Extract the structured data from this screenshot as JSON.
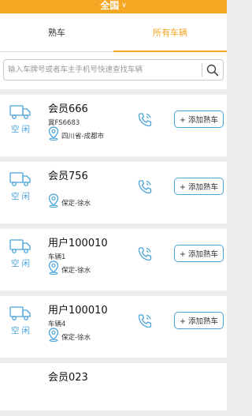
{
  "header": {
    "title": "全国"
  },
  "tabs": [
    {
      "label": "熟车",
      "active": false
    },
    {
      "label": "所有车辆",
      "active": true
    }
  ],
  "search": {
    "placeholder": "输入车牌号或者车主手机号快速查找车辆",
    "value": ""
  },
  "vehicles": [
    {
      "name": "会员666",
      "plate": "冀FS6683",
      "location": "四川省-成都市",
      "status": "空闲",
      "action": "+ 添加熟车"
    },
    {
      "name": "会员756",
      "plate": "",
      "location": "保定-徐水",
      "status": "空闲",
      "action": "+ 添加熟车"
    },
    {
      "name": "用户100010",
      "plate": "车辆1",
      "location": "保定-徐水",
      "status": "空闲",
      "action": "+ 添加熟车"
    },
    {
      "name": "用户100010",
      "plate": "车辆4",
      "location": "保定-徐水",
      "status": "空闲",
      "action": "+ 添加熟车"
    },
    {
      "name": "会员023",
      "plate": "",
      "location": "",
      "status": "",
      "action": ""
    }
  ],
  "colors": {
    "accent": "#f5a623",
    "blue": "#4aa3d8",
    "background": "#ececec"
  },
  "icons": [
    "chevron-down-icon",
    "search-icon",
    "truck-icon",
    "location-pin-icon",
    "phone-icon"
  ]
}
